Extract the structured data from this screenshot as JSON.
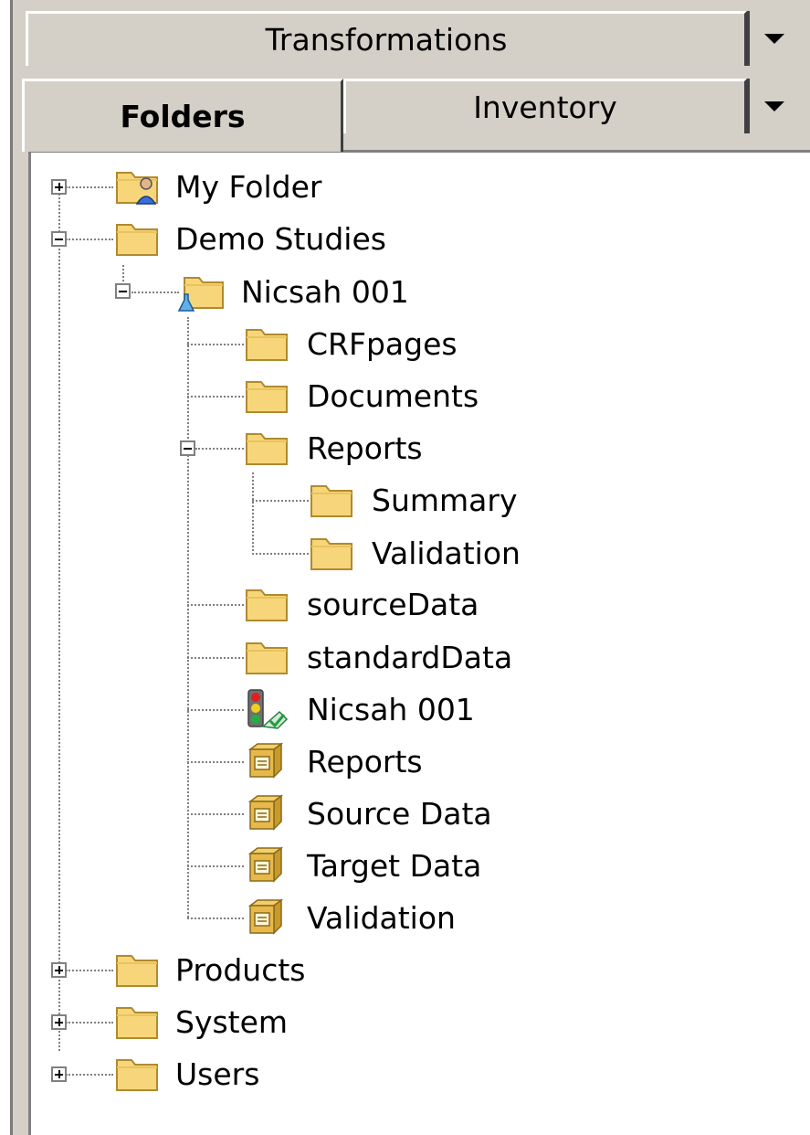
{
  "tabs_top": {
    "label": "Transformations"
  },
  "tabs_second": {
    "active_label": "Folders",
    "other_label": "Inventory"
  },
  "tree": {
    "my_folder": "My Folder",
    "demo_studies": "Demo Studies",
    "nicsah": "Nicsah 001",
    "crfpages": "CRFpages",
    "documents": "Documents",
    "reports": "Reports",
    "summary": "Summary",
    "validation": "Validation",
    "sourcedata": "sourceData",
    "standarddata": "standardData",
    "nicsah_wf": "Nicsah 001",
    "reports_pkg": "Reports",
    "source_pkg": "Source Data",
    "target_pkg": "Target Data",
    "validation_pkg": "Validation",
    "products": "Products",
    "system": "System",
    "users": "Users"
  },
  "icons": {
    "folder_color": "#f7d67b",
    "folder_edge": "#b08a2e"
  }
}
